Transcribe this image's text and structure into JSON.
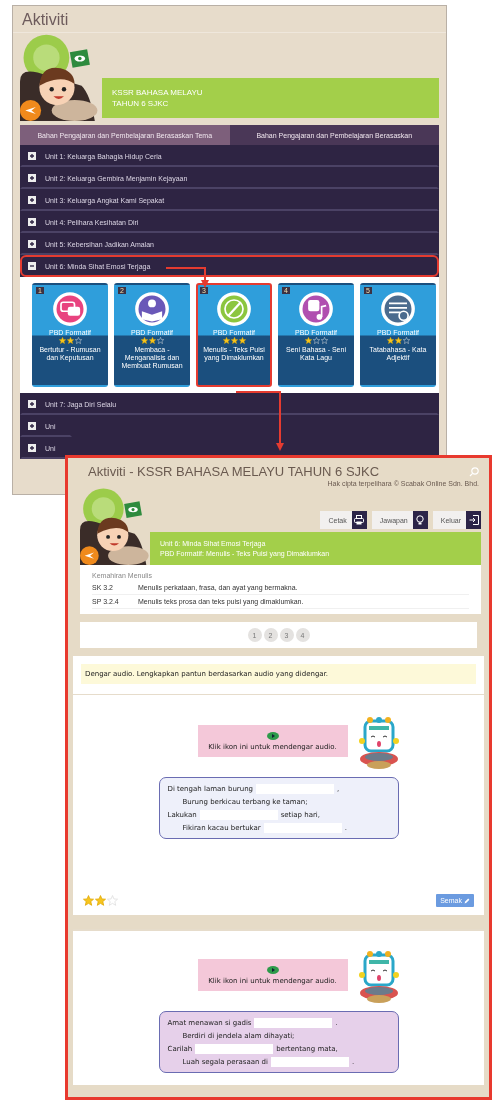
{
  "window": {
    "title": "Aktiviti"
  },
  "banner": {
    "lines": [
      "KSSR BAHASA MELAYU",
      "TAHUN 6 SJKC"
    ]
  },
  "tabs": [
    {
      "label": "Bahan Pengajaran dan Pembelajaran Berasaskan Tema",
      "selected": true
    },
    {
      "label": "Bahan Pengajaran dan Pembelajaran Berasaskan",
      "selected": false
    }
  ],
  "units": [
    {
      "label": "Unit 1: Keluarga Bahagia Hidup Ceria",
      "expanded": false,
      "highlighted": false
    },
    {
      "label": "Unit 2: Keluarga Gembira Menjamin Kejayaan",
      "expanded": false,
      "highlighted": false
    },
    {
      "label": "Unit 3: Keluarga Angkat Kami Sepakat",
      "expanded": false,
      "highlighted": false
    },
    {
      "label": "Unit 4: Pelihara Kesihatan Diri",
      "expanded": false,
      "highlighted": false
    },
    {
      "label": "Unit 5: Kebersihan Jadikan Amalan",
      "expanded": false,
      "highlighted": false
    },
    {
      "label": "Unit 6: Minda Sihat Emosi Terjaga",
      "expanded": true,
      "highlighted": true,
      "activities": [
        {
          "number": "1",
          "type": "PBD Formatif",
          "stars": 2,
          "title": "Bertutur - Rumusan dan Keputusan",
          "color": "#e8437f",
          "kind": "speech",
          "highlighted": false
        },
        {
          "number": "2",
          "type": "PBD Formatif",
          "stars": 2,
          "title": "Membaca - Menganalisis dan Membuat Rumusan",
          "color": "#6a58b8",
          "kind": "reading",
          "highlighted": false
        },
        {
          "number": "3",
          "type": "PBD Formatif",
          "stars": 3,
          "title": "Menulis - Teks Puisi yang Dimaklumkan",
          "color": "#8cc63f",
          "kind": "writing",
          "highlighted": true
        },
        {
          "number": "4",
          "type": "PBD Formatif",
          "stars": 1,
          "title": "Seni Bahasa - Seni Kata Lagu",
          "color": "#b04fb0",
          "kind": "music",
          "highlighted": false
        },
        {
          "number": "5",
          "type": "PBD Formatif",
          "stars": 2,
          "title": "Tatabahasa - Kata Adjektif",
          "color": "#4b6b8e",
          "kind": "grammar",
          "highlighted": false
        }
      ]
    },
    {
      "label": "Unit 7: Jaga Diri Selalu",
      "expanded": false,
      "highlighted": false
    },
    {
      "label": "Uni",
      "expanded": false,
      "highlighted": false
    },
    {
      "label": "Uni",
      "expanded": false,
      "highlighted": false
    }
  ],
  "detail": {
    "title": "Aktiviti - KSSR BAHASA MELAYU TAHUN 6 SJKC",
    "copyright": "Hak cipta terpelihara © Scabak Online Sdn. Bhd.",
    "buttons": [
      {
        "label": "Cetak",
        "kind": "print"
      },
      {
        "label": "Jawapan",
        "kind": "hint"
      },
      {
        "label": "Keluar",
        "kind": "exit"
      }
    ],
    "banner": {
      "lines": [
        "Unit 6: Minda Sihat Emosi Terjaga",
        "PBD Formatif: Menulis - Teks Puisi yang Dimaklumkan"
      ]
    },
    "standards": {
      "heading": "Kemahiran Menulis",
      "rows": [
        {
          "code": "SK 3.2",
          "text": "Menulis perkataan, frasa, dan ayat yang bermakna."
        },
        {
          "code": "SP 3.2.4",
          "text": "Menulis teks prosa dan teks puisi yang dimaklumkan."
        }
      ]
    },
    "pages": [
      "1",
      "2",
      "3",
      "4"
    ],
    "instruction": "Dengar audio. Lengkapkan pantun berdasarkan audio yang didengar.",
    "questions": [
      {
        "prompt": "Klik ikon ini untuk mendengar audio.",
        "color": "#eef0fa",
        "lines": [
          {
            "indent": false,
            "parts": [
              {
                "kind": "text",
                "text": "Di tengah laman burung"
              },
              {
                "kind": "blank"
              },
              {
                "kind": "text",
                "text": ","
              }
            ]
          },
          {
            "indent": true,
            "parts": [
              {
                "kind": "text",
                "text": "Burung berkicau terbang ke taman;"
              }
            ]
          },
          {
            "indent": false,
            "parts": [
              {
                "kind": "text",
                "text": "Lakukan"
              },
              {
                "kind": "blank"
              },
              {
                "kind": "text",
                "text": "setiap hari,"
              }
            ]
          },
          {
            "indent": true,
            "parts": [
              {
                "kind": "text",
                "text": "Fikiran kacau bertukar"
              },
              {
                "kind": "blank"
              },
              {
                "kind": "text",
                "text": "."
              }
            ]
          }
        ],
        "stars": 2,
        "button": "Semak"
      },
      {
        "prompt": "Klik ikon ini untuk mendengar audio.",
        "color": "#e6d0ea",
        "lines": [
          {
            "indent": false,
            "parts": [
              {
                "kind": "text",
                "text": "Amat menawan si gadis"
              },
              {
                "kind": "blank"
              },
              {
                "kind": "text",
                "text": "."
              }
            ]
          },
          {
            "indent": true,
            "parts": [
              {
                "kind": "text",
                "text": "Berdiri di jendela alam dihayati;"
              }
            ]
          },
          {
            "indent": false,
            "parts": [
              {
                "kind": "text",
                "text": "Carilah"
              },
              {
                "kind": "blank"
              },
              {
                "kind": "text",
                "text": "bertentang mata,"
              }
            ]
          },
          {
            "indent": true,
            "parts": [
              {
                "kind": "text",
                "text": "Luah segala perasaan di"
              },
              {
                "kind": "blank"
              },
              {
                "kind": "text",
                "text": "."
              }
            ]
          }
        ]
      }
    ]
  }
}
